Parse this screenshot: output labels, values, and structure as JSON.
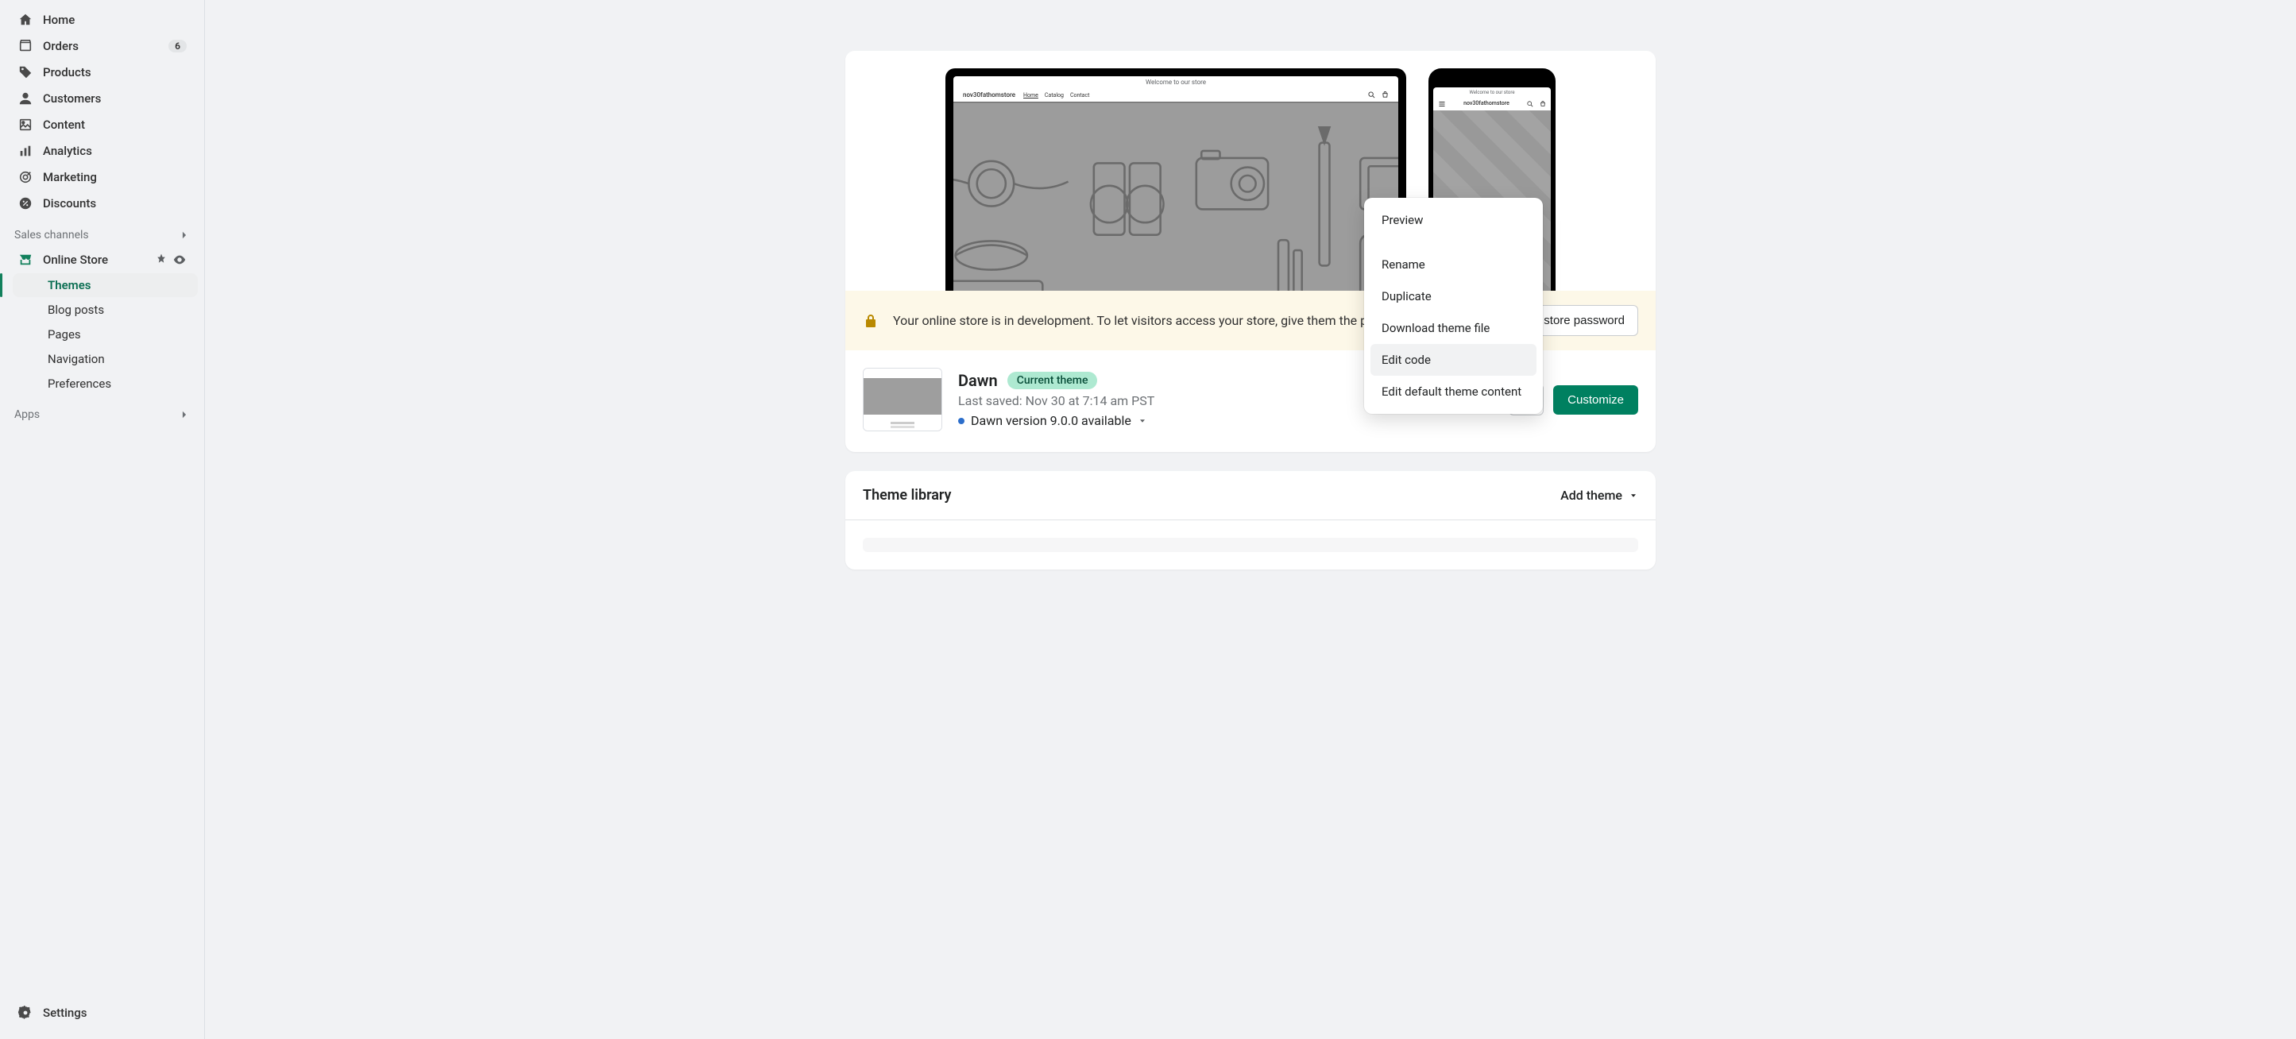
{
  "sidebar": {
    "main": [
      {
        "label": "Home",
        "icon": "home"
      },
      {
        "label": "Orders",
        "icon": "orders",
        "badge": "6"
      },
      {
        "label": "Products",
        "icon": "products"
      },
      {
        "label": "Customers",
        "icon": "customers"
      },
      {
        "label": "Content",
        "icon": "content"
      },
      {
        "label": "Analytics",
        "icon": "analytics"
      },
      {
        "label": "Marketing",
        "icon": "marketing"
      },
      {
        "label": "Discounts",
        "icon": "discounts"
      }
    ],
    "section_label": "Sales channels",
    "channel": {
      "label": "Online Store"
    },
    "sub": [
      {
        "label": "Themes",
        "active": true
      },
      {
        "label": "Blog posts"
      },
      {
        "label": "Pages"
      },
      {
        "label": "Navigation"
      },
      {
        "label": "Preferences"
      }
    ],
    "apps_label": "Apps",
    "settings_label": "Settings"
  },
  "preview": {
    "announcement": "Welcome to our store",
    "brand_desktop": "nov30fathomstore",
    "brand_mobile": "nov30fathomstore",
    "nav": [
      "Home",
      "Catalog",
      "Contact"
    ]
  },
  "banner": {
    "message": "Your online store is in development. To let visitors access your store, give them the password.",
    "button": "Manage store password"
  },
  "theme": {
    "name": "Dawn",
    "pill": "Current theme",
    "saved": "Last saved: Nov 30 at 7:14 am PST",
    "version": "Dawn version 9.0.0 available",
    "customize": "Customize"
  },
  "library": {
    "title": "Theme library",
    "add": "Add theme"
  },
  "popover": {
    "items": [
      {
        "label": "Preview"
      },
      {
        "label": "Rename"
      },
      {
        "label": "Duplicate"
      },
      {
        "label": "Download theme file"
      },
      {
        "label": "Edit code",
        "highlighted": true
      },
      {
        "label": "Edit default theme content"
      }
    ]
  }
}
